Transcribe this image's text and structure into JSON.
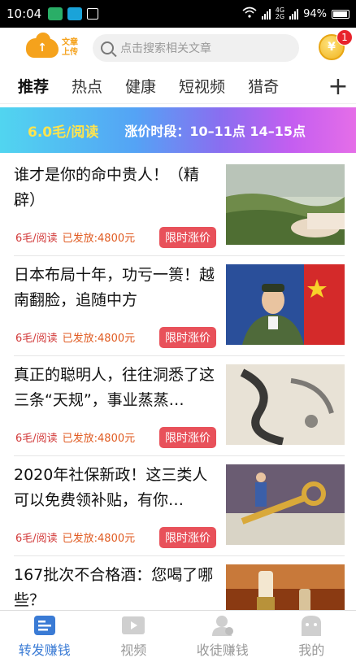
{
  "status_bar": {
    "time": "10:04",
    "network": [
      "4G",
      "2G"
    ],
    "battery": "94%"
  },
  "header": {
    "upload_icon": "cloud-upload-icon",
    "upload_label": [
      "文章",
      "上传"
    ],
    "search_placeholder": "点击搜索相关文章",
    "coin_icon": "coin-icon",
    "coin_symbol": "¥",
    "notification_count": "1"
  },
  "tabs": [
    {
      "label": "推荐",
      "active": true
    },
    {
      "label": "热点"
    },
    {
      "label": "健康"
    },
    {
      "label": "短视频"
    },
    {
      "label": "猎奇"
    }
  ],
  "add_tab_icon": "plus-icon",
  "banner": {
    "rate": "6.0毛/阅读",
    "time_slots": "涨价时段：10–11点 14–15点"
  },
  "articles": [
    {
      "title": "谁才是你的命中贵人！（精辟）",
      "rate": "6毛/阅读",
      "issued": "已发放:4800元",
      "tag": "限时涨价",
      "thumb": "tea-plantation"
    },
    {
      "title": "日本布局十年，功亏一篑！越南翻脸，追随中方",
      "rate": "6毛/阅读",
      "issued": "已发放:4800元",
      "tag": "限时涨价",
      "thumb": "military-spokesman"
    },
    {
      "title": "真正的聪明人，往往洞悉了这三条“天规”，事业蒸蒸…",
      "rate": "6毛/阅读",
      "issued": "已发放:4800元",
      "tag": "限时涨价",
      "thumb": "ink-wash-painting"
    },
    {
      "title": "2020年社保新政！这三类人可以免费领补贴，有你…",
      "rate": "6毛/阅读",
      "issued": "已发放:4800元",
      "tag": "限时涨价",
      "thumb": "social-security-key"
    },
    {
      "title": "167批次不合格酒：您喝了哪些？",
      "rate": "",
      "issued": "",
      "tag": "",
      "thumb": "liquor-bottles"
    }
  ],
  "bottom_nav": [
    {
      "label": "转发赚钱",
      "icon": "share-doc-icon",
      "active": true
    },
    {
      "label": "视频",
      "icon": "video-play-icon"
    },
    {
      "label": "收徒赚钱",
      "icon": "user-add-icon"
    },
    {
      "label": "我的",
      "icon": "face-icon"
    }
  ],
  "colors": {
    "accent": "#3a7bd5",
    "hot_tag": "#e8515a",
    "rate_text": "#d23a3a",
    "banner_rate": "#ffe44d",
    "upload_orange": "#f5a21c"
  }
}
